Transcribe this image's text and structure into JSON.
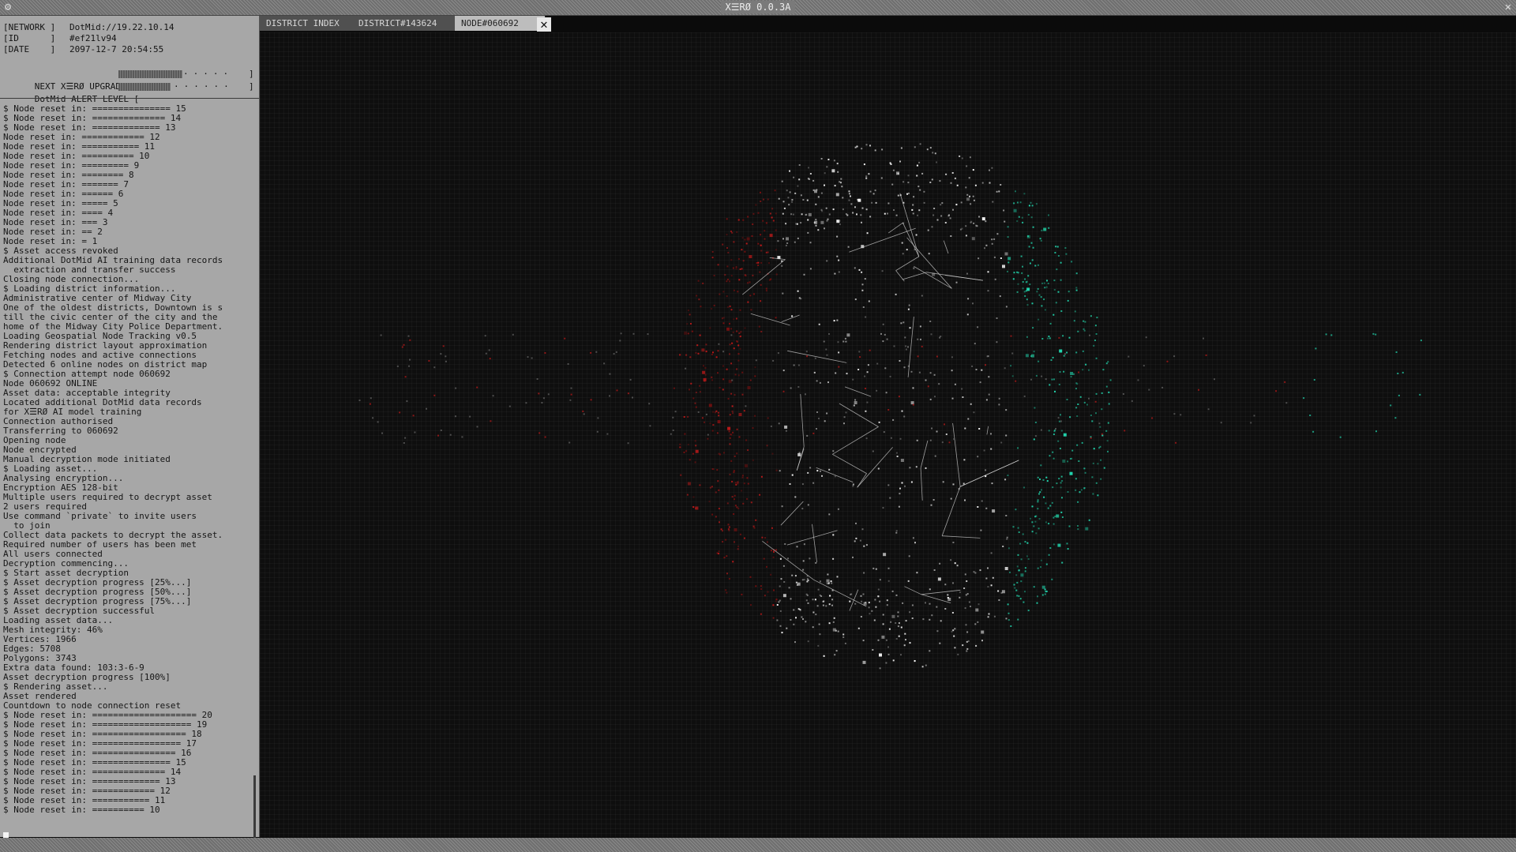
{
  "window": {
    "title": "X☰RØ 0.0.3A",
    "menu_icon": "gear-icon",
    "close_icon": "close-icon"
  },
  "header": {
    "network_key": "[NETWORK ]",
    "network": "DotMid://19.22.10.14",
    "id_key": "[ID      ]",
    "id": "#ef21lv94",
    "date_key": "[DATE    ]",
    "date": "2097-12-7 20:54:55"
  },
  "meters": {
    "upgrade_label": "NEXT X☰RØ UPGRADE [",
    "upgrade_level": 0.45,
    "alert_label": "DotMid ALERT LEVEL [",
    "alert_level": 0.4,
    "end": "]"
  },
  "tabs": [
    {
      "label": "DISTRICT INDEX",
      "active": false
    },
    {
      "label": "DISTRICT#143624",
      "active": false
    },
    {
      "label": "NODE#060692",
      "active": true
    }
  ],
  "log": [
    "$ Node reset in: =============== 15",
    "$ Node reset in: ============== 14",
    "$ Node reset in: ============= 13",
    "Node reset in: ============ 12",
    "Node reset in: =========== 11",
    "Node reset in: ========== 10",
    "Node reset in: ========= 9",
    "Node reset in: ======== 8",
    "Node reset in: ======= 7",
    "Node reset in: ====== 6",
    "Node reset in: ===== 5",
    "Node reset in: ==== 4",
    "Node reset in: === 3",
    "Node reset in: == 2",
    "Node reset in: = 1",
    "$ Asset access revoked",
    "Additional DotMid AI training data records",
    "  extraction and transfer success",
    "Closing node connection...",
    "$ Loading district information...",
    "Administrative center of Midway City",
    "One of the oldest districts, Downtown is s",
    "till the civic center of the city and the",
    "home of the Midway City Police Department.",
    "Loading Geospatial Node Tracking v0.5",
    "Rendering district layout approximation",
    "Fetching nodes and active connections",
    "Detected 6 online nodes on district map",
    "$ Connection attempt node 060692",
    "Node 060692 ONLINE",
    "Asset data: acceptable integrity",
    "Located additional DotMid data records",
    "for X☰RØ AI model training",
    "Connection authorised",
    "Transferring to 060692",
    "Opening node",
    "Node encrypted",
    "Manual decryption mode initiated",
    "$ Loading asset...",
    "Analysing encryption...",
    "Encryption AES 128-bit",
    "Multiple users required to decrypt asset",
    "2 users required",
    "Use command `private` to invite users",
    "  to join",
    "Collect data packets to decrypt the asset.",
    "Required number of users has been met",
    "All users connected",
    "Decryption commencing...",
    "$ Start asset decryption",
    "$ Asset decryption progress [25%...]",
    "$ Asset decryption progress [50%...]",
    "$ Asset decryption progress [75%...]",
    "$ Asset decryption successful",
    "Loading asset data...",
    "Mesh integrity: 46%",
    "Vertices: 1966",
    "Edges: 5708",
    "Polygons: 3743",
    "Extra data found: 103:3-6-9",
    "Asset decryption progress [100%]",
    "$ Rendering asset...",
    "Asset rendered",
    "Countdown to node connection reset",
    "$ Node reset in: ==================== 20",
    "$ Node reset in: =================== 19",
    "$ Node reset in: ================== 18",
    "$ Node reset in: ================= 17",
    "$ Node reset in: ================ 16",
    "$ Node reset in: =============== 15",
    "$ Node reset in: ============== 14",
    "$ Node reset in: ============= 13",
    "$ Node reset in: ============ 12",
    "$ Node reset in: =========== 11",
    "$ Node reset in: ========== 10"
  ],
  "colors": {
    "panel": "#a7a7a7",
    "viewport": "#0e0e0e",
    "mesh": "#d8d8d8",
    "teal": "#22d8b0",
    "red": "#c21a1a"
  }
}
